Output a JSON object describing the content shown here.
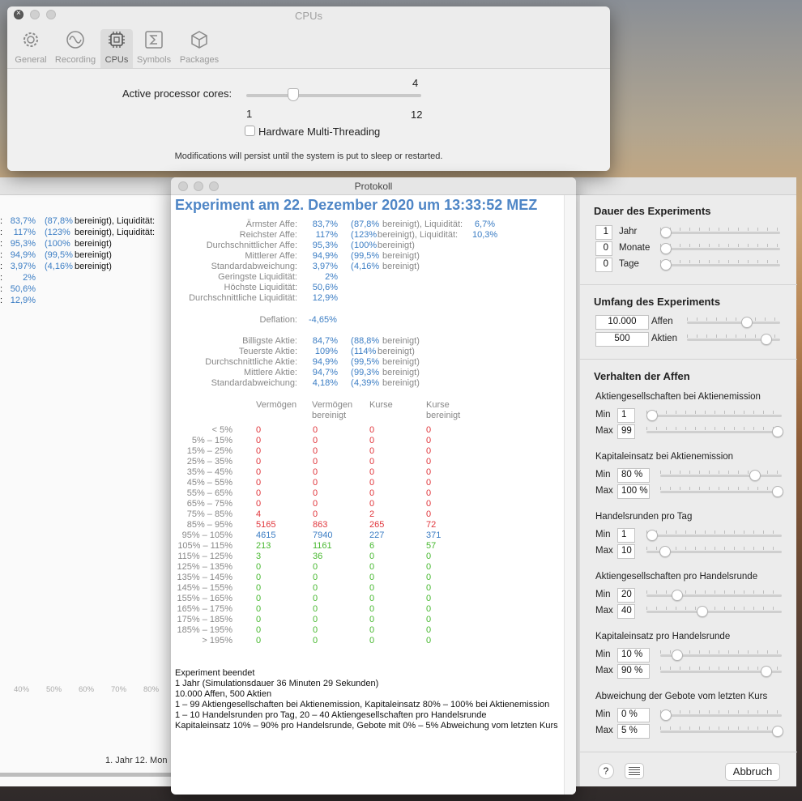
{
  "prefs": {
    "title": "CPUs",
    "tabs": [
      {
        "label": "General",
        "icon": "gear-icon"
      },
      {
        "label": "Recording",
        "icon": "waveform-icon"
      },
      {
        "label": "CPUs",
        "icon": "chip-icon"
      },
      {
        "label": "Symbols",
        "icon": "sigma-icon"
      },
      {
        "label": "Packages",
        "icon": "package-icon"
      }
    ],
    "cores_label": "Active processor cores:",
    "cores_value": "4",
    "cores_min": "1",
    "cores_max": "12",
    "cores_fraction": 0.27,
    "ht_label": "Hardware Multi-Threading",
    "note": "Modifications will persist until the system is put to sleep or restarted."
  },
  "back": {
    "rows": [
      {
        "v": "83,7%",
        "b": "(87,8%",
        "t": "bereinigt), Liquidität:"
      },
      {
        "v": "117%",
        "b": "(123%",
        "t": "bereinigt), Liquidität:"
      },
      {
        "v": "95,3%",
        "b": "(100%",
        "t": "bereinigt)"
      },
      {
        "v": "94,9%",
        "b": "(99,5%",
        "t": "bereinigt)"
      },
      {
        "v": "3,97%",
        "b": "(4,16%",
        "t": "bereinigt)"
      },
      {
        "v": "2%"
      },
      {
        "v": "50,6%"
      },
      {
        "v": "12,9%"
      }
    ],
    "axis": [
      "40%",
      "50%",
      "60%",
      "70%",
      "80%"
    ],
    "footer": "1. Jahr  12. Mon"
  },
  "proto": {
    "title": "Protokoll",
    "heading": "Experiment am 22. Dezember 2020 um 13:33:52 MEZ",
    "stats1": [
      {
        "l": "Ärmster Affe:",
        "v": "83,7%",
        "b": "87,8%",
        "liq": "6,7%"
      },
      {
        "l": "Reichster Affe:",
        "v": "117%",
        "b": "123%",
        "liq": "10,3%"
      },
      {
        "l": "Durchschnittlicher Affe:",
        "v": "95,3%",
        "b": "100%"
      },
      {
        "l": "Mittlerer Affe:",
        "v": "94,9%",
        "b": "99,5%"
      },
      {
        "l": "Standardabweichung:",
        "v": "3,97%",
        "b": "4,16%"
      },
      {
        "l": "Geringste Liquidität:",
        "v": "2%"
      },
      {
        "l": "Höchste Liquidität:",
        "v": "50,6%"
      },
      {
        "l": "Durchschnittliche Liquidität:",
        "v": "12,9%"
      }
    ],
    "bereinigt": "bereinigt)",
    "bereinigt_liq": "bereinigt), Liquidität:",
    "deflation_label": "Deflation:",
    "deflation": "-4,65%",
    "stats2": [
      {
        "l": "Billigste Aktie:",
        "v": "84,7%",
        "b": "88,8%"
      },
      {
        "l": "Teuerste Aktie:",
        "v": "109%",
        "b": "114%"
      },
      {
        "l": "Durchschnittliche Aktie:",
        "v": "94,9%",
        "b": "99,5%"
      },
      {
        "l": "Mittlere Aktie:",
        "v": "94,7%",
        "b": "99,3%"
      },
      {
        "l": "Standardabweichung:",
        "v": "4,18%",
        "b": "4,39%"
      }
    ],
    "headers": [
      "Vermögen",
      "Vermögen\nbereinigt",
      "Kurse",
      "Kurse\nbereinigt"
    ],
    "dist": [
      {
        "r": "<    5%",
        "c": [
          "0",
          "0",
          "0",
          "0"
        ],
        "k": "red"
      },
      {
        "r": "5% –  15%",
        "c": [
          "0",
          "0",
          "0",
          "0"
        ],
        "k": "red"
      },
      {
        "r": "15% –  25%",
        "c": [
          "0",
          "0",
          "0",
          "0"
        ],
        "k": "red"
      },
      {
        "r": "25% –  35%",
        "c": [
          "0",
          "0",
          "0",
          "0"
        ],
        "k": "red"
      },
      {
        "r": "35% –  45%",
        "c": [
          "0",
          "0",
          "0",
          "0"
        ],
        "k": "red"
      },
      {
        "r": "45% –  55%",
        "c": [
          "0",
          "0",
          "0",
          "0"
        ],
        "k": "red"
      },
      {
        "r": "55% –  65%",
        "c": [
          "0",
          "0",
          "0",
          "0"
        ],
        "k": "red"
      },
      {
        "r": "65% –  75%",
        "c": [
          "0",
          "0",
          "0",
          "0"
        ],
        "k": "red"
      },
      {
        "r": "75% –  85%",
        "c": [
          "4",
          "0",
          "2",
          "0"
        ],
        "k": "red"
      },
      {
        "r": "85% –  95%",
        "c": [
          "5165",
          "863",
          "265",
          "72"
        ],
        "k": "red"
      },
      {
        "r": "95% – 105%",
        "c": [
          "4615",
          "7940",
          "227",
          "371"
        ],
        "k": "blue"
      },
      {
        "r": "105% – 115%",
        "c": [
          "213",
          "1161",
          "6",
          "57"
        ],
        "k": "grn"
      },
      {
        "r": "115% – 125%",
        "c": [
          "3",
          "36",
          "0",
          "0"
        ],
        "k": "grn"
      },
      {
        "r": "125% – 135%",
        "c": [
          "0",
          "0",
          "0",
          "0"
        ],
        "k": "grn"
      },
      {
        "r": "135% – 145%",
        "c": [
          "0",
          "0",
          "0",
          "0"
        ],
        "k": "grn"
      },
      {
        "r": "145% – 155%",
        "c": [
          "0",
          "0",
          "0",
          "0"
        ],
        "k": "grn"
      },
      {
        "r": "155% – 165%",
        "c": [
          "0",
          "0",
          "0",
          "0"
        ],
        "k": "grn"
      },
      {
        "r": "165% – 175%",
        "c": [
          "0",
          "0",
          "0",
          "0"
        ],
        "k": "grn"
      },
      {
        "r": "175% – 185%",
        "c": [
          "0",
          "0",
          "0",
          "0"
        ],
        "k": "grn"
      },
      {
        "r": "185% – 195%",
        "c": [
          "0",
          "0",
          "0",
          "0"
        ],
        "k": "grn"
      },
      {
        "r": "> 195%",
        "c": [
          "0",
          "0",
          "0",
          "0"
        ],
        "k": "grn"
      }
    ],
    "summary": [
      "Experiment beendet",
      "1 Jahr   (Simulationsdauer  36 Minuten  29 Sekunden)",
      "10.000 Affen, 500 Aktien",
      "1 – 99 Aktiengesellschaften bei Aktienemission, Kapitaleinsatz 80% – 100% bei Aktienemission",
      "1 – 10 Handelsrunden pro Tag, 20 – 40 Aktiengesellschaften pro Handelsrunde",
      "Kapitaleinsatz 10% – 90% pro Handelsrunde, Gebote mit 0% – 5% Abweichung vom letzten Kurs"
    ]
  },
  "side": {
    "dauer_title": "Dauer des Experiments",
    "dauer": [
      {
        "v": "1",
        "l": "Jahr",
        "f": 0
      },
      {
        "v": "0",
        "l": "Monate",
        "f": 0
      },
      {
        "v": "0",
        "l": "Tage",
        "f": 0
      }
    ],
    "umfang_title": "Umfang des Experiments",
    "umfang": [
      {
        "v": "10.000",
        "l": "Affen",
        "f": 0.65
      },
      {
        "v": "500",
        "l": "Aktien",
        "f": 0.88
      }
    ],
    "verhalten_title": "Verhalten der Affen",
    "min": "Min",
    "max": "Max",
    "groups": [
      {
        "t": "Aktiengesellschaften bei Aktienemission",
        "min": "1",
        "max": "99",
        "fmin": 0,
        "fmax": 1
      },
      {
        "t": "Kapitaleinsatz bei Aktienemission",
        "min": "80 %",
        "max": "100 %",
        "fmin": 0.8,
        "fmax": 1
      },
      {
        "t": "Handelsrunden pro Tag",
        "min": "1",
        "max": "10",
        "fmin": 0,
        "fmax": 0.1
      },
      {
        "t": "Aktiengesellschaften pro Handelsrunde",
        "min": "20",
        "max": "40",
        "fmin": 0.2,
        "fmax": 0.4
      },
      {
        "t": "Kapitaleinsatz pro Handelsrunde",
        "min": "10 %",
        "max": "90 %",
        "fmin": 0.1,
        "fmax": 0.9
      },
      {
        "t": "Abweichung der Gebote vom letzten Kurs",
        "min": "0 %",
        "max": "5 %",
        "fmin": 0,
        "fmax": 1
      }
    ],
    "help": "?",
    "cancel": "Abbruch"
  }
}
